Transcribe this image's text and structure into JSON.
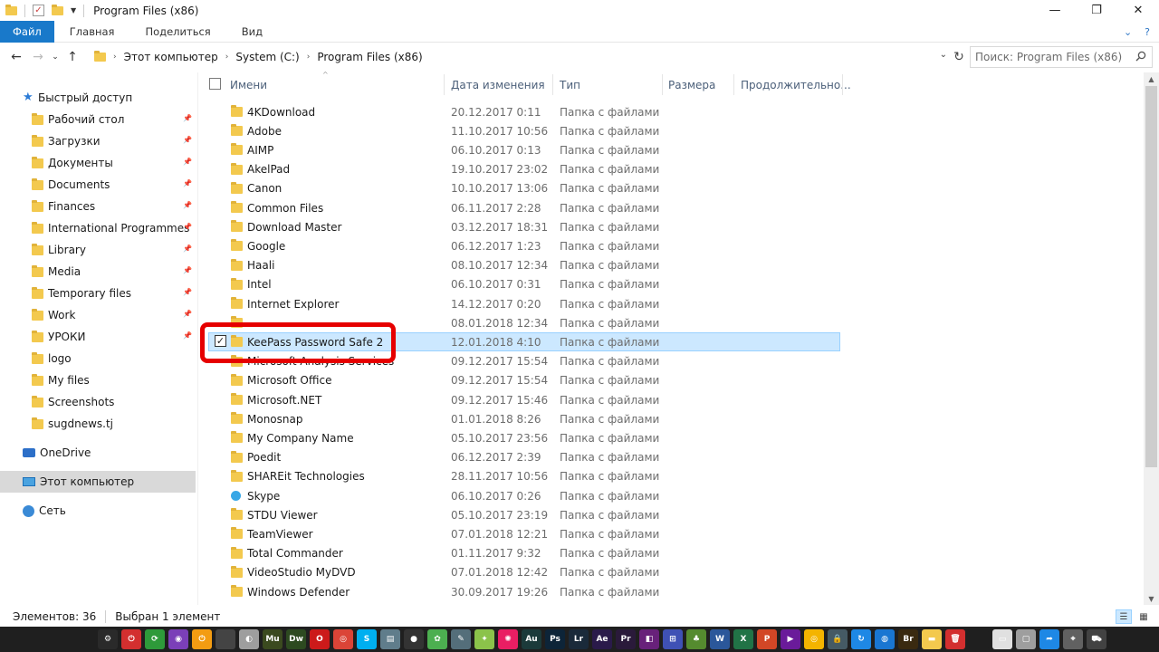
{
  "window": {
    "title": "Program Files (x86)",
    "controls": {
      "minimize": "—",
      "restore": "❐",
      "close": "✕"
    }
  },
  "ribbon": {
    "tabs": [
      "Файл",
      "Главная",
      "Поделиться",
      "Вид"
    ]
  },
  "address": {
    "crumbs": [
      "Этот компьютер",
      "System (C:)",
      "Program Files (x86)"
    ],
    "search_placeholder": "Поиск: Program Files (x86)"
  },
  "nav": {
    "quick_access": "Быстрый доступ",
    "items": [
      {
        "label": "Рабочий стол",
        "pinned": true
      },
      {
        "label": "Загрузки",
        "pinned": true
      },
      {
        "label": "Документы",
        "pinned": true
      },
      {
        "label": "Documents",
        "pinned": true
      },
      {
        "label": "Finances",
        "pinned": true
      },
      {
        "label": "International Programmes",
        "pinned": true
      },
      {
        "label": "Library",
        "pinned": true
      },
      {
        "label": "Media",
        "pinned": true
      },
      {
        "label": "Temporary files",
        "pinned": true
      },
      {
        "label": "Work",
        "pinned": true
      },
      {
        "label": "УРОКИ",
        "pinned": true
      },
      {
        "label": "logo",
        "pinned": false
      },
      {
        "label": "My files",
        "pinned": false
      },
      {
        "label": "Screenshots",
        "pinned": false
      },
      {
        "label": "sugdnews.tj",
        "pinned": false
      }
    ],
    "onedrive": "OneDrive",
    "this_pc": "Этот компьютер",
    "network": "Сеть"
  },
  "columns": {
    "name": "Имени",
    "date": "Дата изменения",
    "type": "Тип",
    "size": "Размера",
    "duration": "Продолжительно..."
  },
  "files": [
    {
      "name": "4KDownload",
      "date": "20.12.2017 0:11",
      "type": "Папка с файлами"
    },
    {
      "name": "Adobe",
      "date": "11.10.2017 10:56",
      "type": "Папка с файлами"
    },
    {
      "name": "AIMP",
      "date": "06.10.2017 0:13",
      "type": "Папка с файлами"
    },
    {
      "name": "AkelPad",
      "date": "19.10.2017 23:02",
      "type": "Папка с файлами"
    },
    {
      "name": "Canon",
      "date": "10.10.2017 13:06",
      "type": "Папка с файлами"
    },
    {
      "name": "Common Files",
      "date": "06.11.2017 2:28",
      "type": "Папка с файлами"
    },
    {
      "name": "Download Master",
      "date": "03.12.2017 18:31",
      "type": "Папка с файлами"
    },
    {
      "name": "Google",
      "date": "06.12.2017 1:23",
      "type": "Папка с файлами"
    },
    {
      "name": "Haali",
      "date": "08.10.2017 12:34",
      "type": "Папка с файлами"
    },
    {
      "name": "Intel",
      "date": "06.10.2017 0:31",
      "type": "Папка с файлами"
    },
    {
      "name": "Internet Explorer",
      "date": "14.12.2017 0:20",
      "type": "Папка с файлами"
    },
    {
      "name": "",
      "date": "08.01.2018 12:34",
      "type": "Папка с файлами"
    },
    {
      "name": "KeePass Password Safe 2",
      "date": "12.01.2018 4:10",
      "type": "Папка с файлами",
      "selected": true
    },
    {
      "name": "Microsoft Analysis Services",
      "date": "09.12.2017 15:54",
      "type": "Папка с файлами"
    },
    {
      "name": "Microsoft Office",
      "date": "09.12.2017 15:54",
      "type": "Папка с файлами"
    },
    {
      "name": "Microsoft.NET",
      "date": "09.12.2017 15:46",
      "type": "Папка с файлами"
    },
    {
      "name": "Monosnap",
      "date": "01.01.2018 8:26",
      "type": "Папка с файлами"
    },
    {
      "name": "My Company Name",
      "date": "05.10.2017 23:56",
      "type": "Папка с файлами"
    },
    {
      "name": "Poedit",
      "date": "06.12.2017 2:39",
      "type": "Папка с файлами"
    },
    {
      "name": "SHAREit Technologies",
      "date": "28.11.2017 10:56",
      "type": "Папка с файлами"
    },
    {
      "name": "Skype",
      "date": "06.10.2017 0:26",
      "type": "Папка с файлами",
      "icon": "skype"
    },
    {
      "name": "STDU Viewer",
      "date": "05.10.2017 23:19",
      "type": "Папка с файлами"
    },
    {
      "name": "TeamViewer",
      "date": "07.01.2018 12:21",
      "type": "Папка с файлами"
    },
    {
      "name": "Total Commander",
      "date": "01.11.2017 9:32",
      "type": "Папка с файлами"
    },
    {
      "name": "VideoStudio MyDVD",
      "date": "07.01.2018 12:42",
      "type": "Папка с файлами"
    },
    {
      "name": "Windows Defender",
      "date": "30.09.2017 19:26",
      "type": "Папка с файлами"
    }
  ],
  "status": {
    "count": "Элементов: 36",
    "selected": "Выбран 1 элемент"
  },
  "taskbar": [
    {
      "name": "settings",
      "label": "⚙",
      "color": "#2a2a2a"
    },
    {
      "name": "power",
      "label": "⏻",
      "color": "#d32f2f"
    },
    {
      "name": "sync",
      "label": "⟳",
      "color": "#2e9a3a"
    },
    {
      "name": "media",
      "label": "◉",
      "color": "#7b3fb8"
    },
    {
      "name": "power-orange",
      "label": "⏻",
      "color": "#f39c12"
    },
    {
      "name": "keyboard",
      "label": "",
      "color": "#444444"
    },
    {
      "name": "disc",
      "label": "◐",
      "color": "#9e9e9e"
    },
    {
      "name": "muse",
      "label": "Mu",
      "color": "#3b4a1f"
    },
    {
      "name": "dreamweaver",
      "label": "Dw",
      "color": "#2d4a20"
    },
    {
      "name": "opera",
      "label": "O",
      "color": "#cc1a1a"
    },
    {
      "name": "chrome",
      "label": "◎",
      "color": "#db4437"
    },
    {
      "name": "skype",
      "label": "S",
      "color": "#00aff0"
    },
    {
      "name": "storage",
      "label": "▤",
      "color": "#607d8b"
    },
    {
      "name": "camera",
      "label": "●",
      "color": "#333333"
    },
    {
      "name": "nature",
      "label": "✿",
      "color": "#4caf50"
    },
    {
      "name": "editor",
      "label": "✎",
      "color": "#546e7a"
    },
    {
      "name": "photos",
      "label": "✦",
      "color": "#8bc34a"
    },
    {
      "name": "picasa",
      "label": "✺",
      "color": "#e91e63"
    },
    {
      "name": "audition",
      "label": "Au",
      "color": "#1b3a3a"
    },
    {
      "name": "photoshop",
      "label": "Ps",
      "color": "#0d2438"
    },
    {
      "name": "lightroom",
      "label": "Lr",
      "color": "#1a2a3a"
    },
    {
      "name": "after-effects",
      "label": "Ae",
      "color": "#2a1a4a"
    },
    {
      "name": "premiere",
      "label": "Pr",
      "color": "#2a1a3a"
    },
    {
      "name": "vs",
      "label": "◧",
      "color": "#68217a"
    },
    {
      "name": "grid",
      "label": "⊞",
      "color": "#3f51b5"
    },
    {
      "name": "leaf",
      "label": "♣",
      "color": "#558b2f"
    },
    {
      "name": "word",
      "label": "W",
      "color": "#2b579a"
    },
    {
      "name": "excel",
      "label": "X",
      "color": "#217346"
    },
    {
      "name": "powerpoint",
      "label": "P",
      "color": "#d24726"
    },
    {
      "name": "video",
      "label": "▶",
      "color": "#6a1b9a"
    },
    {
      "name": "chrome2",
      "label": "◎",
      "color": "#f4b400"
    },
    {
      "name": "lock",
      "label": "🔒",
      "color": "#455a64"
    },
    {
      "name": "refresh",
      "label": "↻",
      "color": "#1e88e5"
    },
    {
      "name": "globe",
      "label": "◍",
      "color": "#1976d2"
    },
    {
      "name": "bridge",
      "label": "Br",
      "color": "#3a2a10"
    },
    {
      "name": "folder",
      "label": "▬",
      "color": "#f3c94e"
    },
    {
      "name": "trash",
      "label": "🗑",
      "color": "#d32f2f"
    },
    {
      "name": "sep",
      "label": "",
      "color": "#1f1f1f"
    },
    {
      "name": "notes",
      "label": "▭",
      "color": "#e0e0e0"
    },
    {
      "name": "window",
      "label": "▢",
      "color": "#9e9e9e"
    },
    {
      "name": "send",
      "label": "➦",
      "color": "#1e88e5"
    },
    {
      "name": "pin",
      "label": "⌖",
      "color": "#616161"
    },
    {
      "name": "car",
      "label": "⛟",
      "color": "#424242"
    }
  ]
}
